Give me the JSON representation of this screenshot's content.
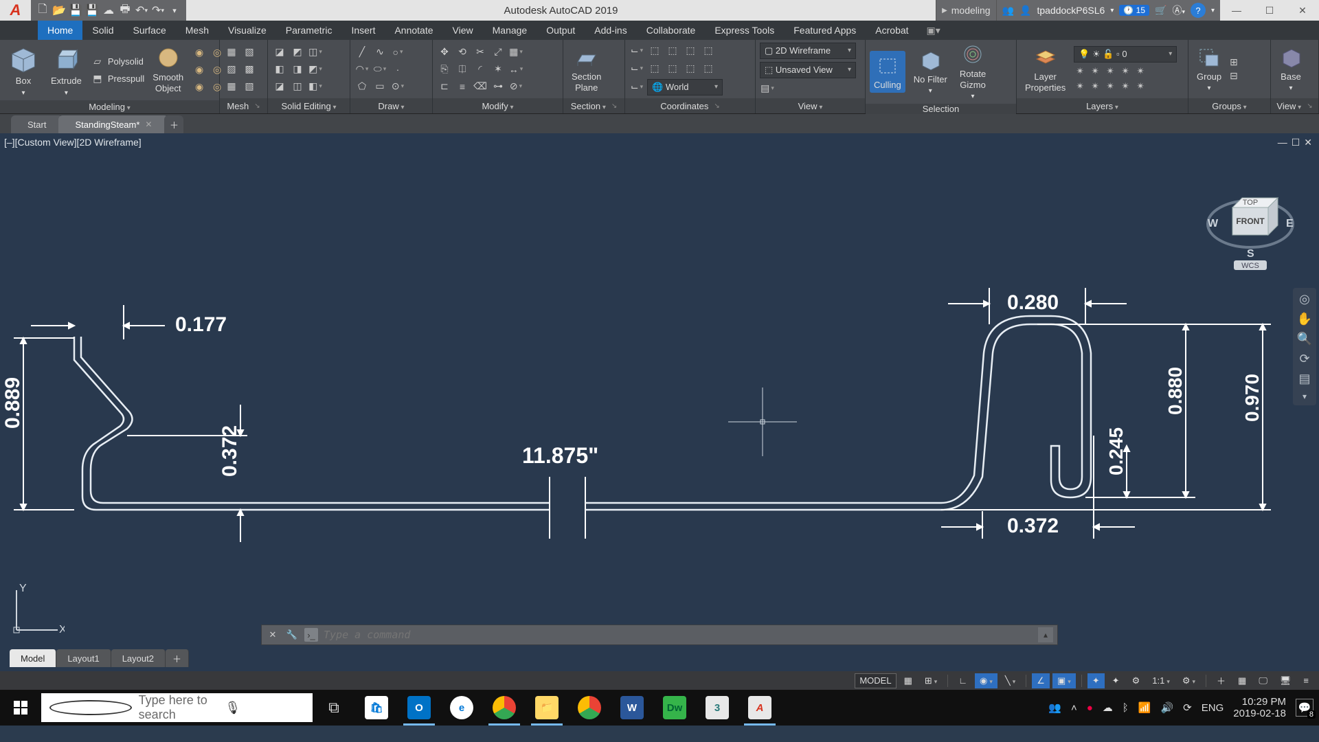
{
  "app": {
    "title": "Autodesk AutoCAD 2019",
    "search_tag": "modeling",
    "user": "tpaddockP6SL6",
    "badge": "15"
  },
  "ribbon_tabs": [
    "Home",
    "Solid",
    "Surface",
    "Mesh",
    "Visualize",
    "Parametric",
    "Insert",
    "Annotate",
    "View",
    "Manage",
    "Output",
    "Add-ins",
    "Collaborate",
    "Express Tools",
    "Featured Apps",
    "Acrobat"
  ],
  "panels": {
    "modeling": {
      "title": "Modeling",
      "box": "Box",
      "extrude": "Extrude",
      "polysolid": "Polysolid",
      "presspull": "Presspull",
      "smooth": "Smooth\nObject"
    },
    "mesh": {
      "title": "Mesh"
    },
    "solid_editing": {
      "title": "Solid Editing"
    },
    "draw": {
      "title": "Draw"
    },
    "modify": {
      "title": "Modify"
    },
    "section": {
      "title": "Section",
      "sectionplane": "Section\nPlane"
    },
    "coordinates": {
      "title": "Coordinates",
      "world": "World"
    },
    "view": {
      "title": "View",
      "style": "2D Wireframe",
      "saved": "Unsaved View"
    },
    "selection": {
      "title": "Selection",
      "culling": "Culling",
      "nofilter": "No Filter",
      "gizmo": "Rotate\nGizmo"
    },
    "layers": {
      "title": "Layers",
      "prop": "Layer\nProperties",
      "value": "0"
    },
    "groups": {
      "title": "Groups",
      "group": "Group",
      "base": "Base"
    },
    "viewpanel": {
      "title": "View"
    }
  },
  "doctabs": {
    "start": "Start",
    "file": "StandingSteam*"
  },
  "viewport_label": "[–][Custom View][2D Wireframe]",
  "viewcube": {
    "top": "TOP",
    "front": "FRONT",
    "w": "W",
    "e": "E",
    "s": "S",
    "wcs": "WCS"
  },
  "dims": {
    "a": "0.177",
    "b": "0.889",
    "c": "0.372",
    "d": "11.875\"",
    "e": "0.280",
    "f": "0.245",
    "g": "0.880",
    "h": "0.970",
    "i": "0.372"
  },
  "command": {
    "placeholder": "Type a command"
  },
  "layout_tabs": [
    "Model",
    "Layout1",
    "Layout2"
  ],
  "status": {
    "model": "MODEL",
    "scale": "1:1",
    "lang": "ENG"
  },
  "taskbar": {
    "search": "Type here to search",
    "time": "10:29 PM",
    "date": "2019-02-18",
    "notif": "8"
  },
  "ucs": {
    "x": "X",
    "y": "Y"
  }
}
